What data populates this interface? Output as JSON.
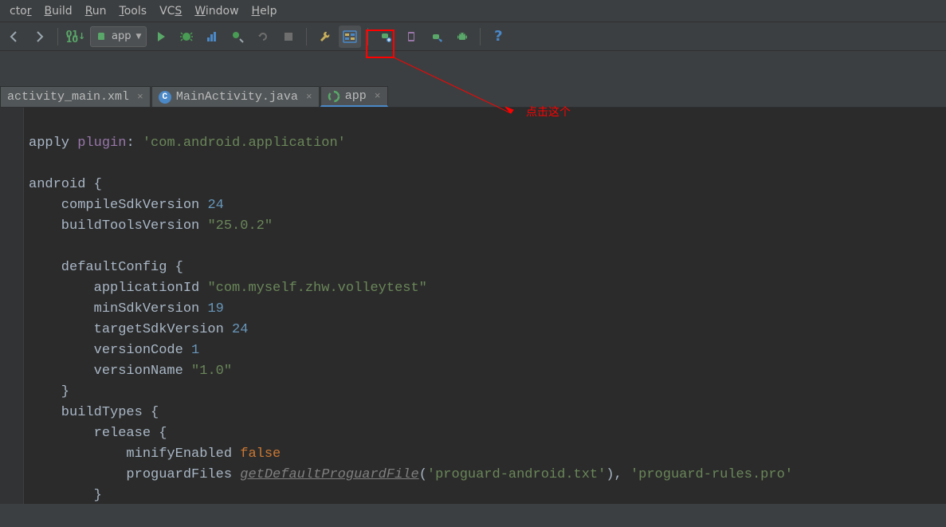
{
  "menus": [
    "ctor",
    "Build",
    "Run",
    "Tools",
    "VCS",
    "Window",
    "Help"
  ],
  "mnemonics": [
    "c",
    "B",
    "R",
    "T",
    "V",
    "W",
    "H"
  ],
  "runConfig": "app",
  "tabs": [
    {
      "label": "activity_main.xml",
      "icon": "xml",
      "active": false
    },
    {
      "label": "MainActivity.java",
      "icon": "c",
      "active": false
    },
    {
      "label": "app",
      "icon": "gradle",
      "active": true
    }
  ],
  "annotation": "点击这个",
  "code": {
    "l1a": "apply ",
    "l1b": "plugin",
    "l1c": ": ",
    "l1d": "'com.android.application'",
    "l2": "android {",
    "l3a": "    compileSdkVersion ",
    "l3b": "24",
    "l4a": "    buildToolsVersion ",
    "l4b": "\"25.0.2\"",
    "l5": "    defaultConfig {",
    "l6a": "        applicationId ",
    "l6b": "\"com.myself.zhw.volleytest\"",
    "l7a": "        minSdkVersion ",
    "l7b": "19",
    "l8a": "        targetSdkVersion ",
    "l8b": "24",
    "l9a": "        versionCode ",
    "l9b": "1",
    "l10a": "        versionName ",
    "l10b": "\"1.0\"",
    "l11": "    }",
    "l12": "    buildTypes {",
    "l13": "        release {",
    "l14a": "            minifyEnabled ",
    "l14b": "false",
    "l15a": "            proguardFiles ",
    "l15b": "getDefaultProguardFile",
    "l15c": "(",
    "l15d": "'proguard-android.txt'",
    "l15e": "), ",
    "l15f": "'proguard-rules.pro'",
    "l16": "        }"
  }
}
